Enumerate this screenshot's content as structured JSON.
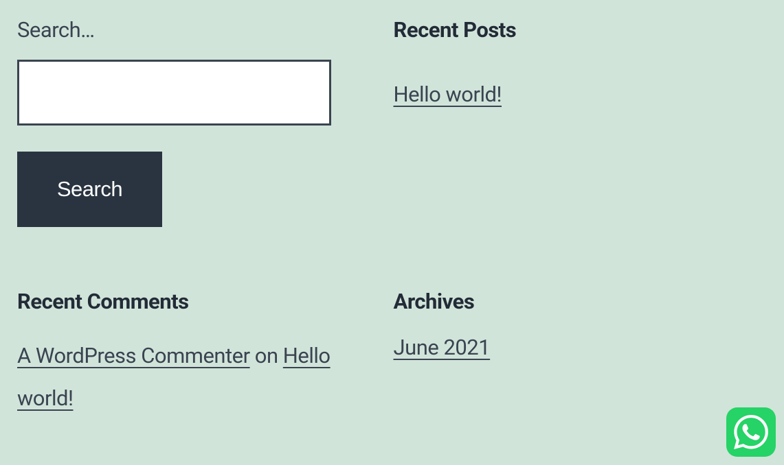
{
  "search": {
    "label": "Search…",
    "button_label": "Search",
    "value": ""
  },
  "recent_posts": {
    "title": "Recent Posts",
    "items": [
      {
        "label": "Hello world!"
      }
    ]
  },
  "recent_comments": {
    "title": "Recent Comments",
    "items": [
      {
        "author": "A WordPress Commenter",
        "connector": " on ",
        "post": "Hello world!"
      }
    ]
  },
  "archives": {
    "title": "Archives",
    "items": [
      {
        "label": "June 2021"
      }
    ]
  }
}
